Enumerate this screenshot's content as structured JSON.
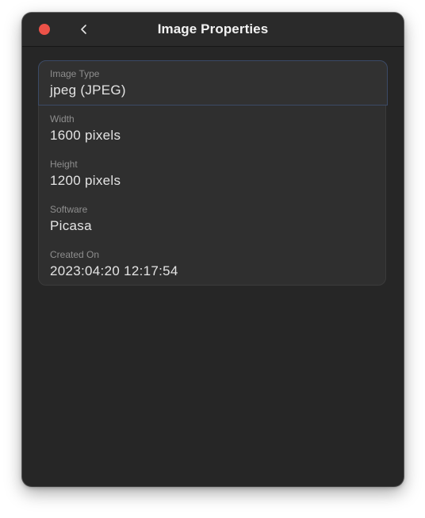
{
  "window": {
    "title": "Image Properties"
  },
  "properties": [
    {
      "label": "Image Type",
      "value": "jpeg (JPEG)"
    },
    {
      "label": "Width",
      "value": "1600 pixels"
    },
    {
      "label": "Height",
      "value": "1200 pixels"
    },
    {
      "label": "Software",
      "value": "Picasa"
    },
    {
      "label": "Created On",
      "value": "2023:04:20 12:17:54"
    }
  ],
  "colors": {
    "background": "#262626",
    "close_button": "#ec5248",
    "focus_ring": "#3b4a66"
  },
  "icons": {
    "close": "close-icon",
    "back": "chevron-left-icon"
  }
}
